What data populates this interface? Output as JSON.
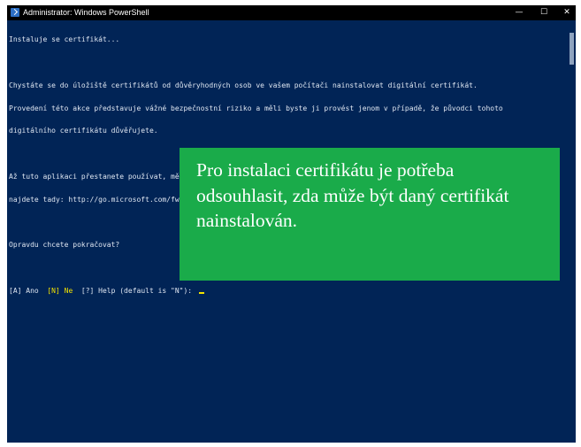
{
  "window": {
    "title": "Administrator: Windows PowerShell",
    "app_icon": "powershell-icon",
    "minimize_glyph": "—",
    "maximize_glyph": "☐",
    "close_glyph": "✕"
  },
  "console": {
    "line1": "Instaluje se certifikát...",
    "line2": "Chystáte se do úložiště certifikátů od důvěryhodných osob ve vašem počítači nainstalovat digitální certifikát.",
    "line3": "Provedení této akce představuje vážné bezpečnostní riziko a měli byste ji provést jenom v případě, že původci tohoto",
    "line4": "digitálního certifikátu důvěřujete.",
    "line5": "Až tuto aplikaci přestanete používat, měli byste přidružený digitální certifikát ručně odebrat. Postup, jak to udělat,",
    "line6": "najdete tady: http://go.microsoft.com/fwlink/?LinkId=243053",
    "line7": "Opravdu chcete pokračovat?",
    "option_a": "[A] Ano  ",
    "option_n": "[N] Ne  ",
    "option_help": "[?] Help (default is \"N\"): "
  },
  "callout": {
    "text": "Pro instalaci certifikátu je potřeba odsouhlasit, zda může být daný certifikát nainstalován."
  },
  "colors": {
    "console_background": "#012456",
    "console_text": "#dfe6f1",
    "highlight_yellow": "#f2e300",
    "callout_green": "#1aab4a"
  }
}
